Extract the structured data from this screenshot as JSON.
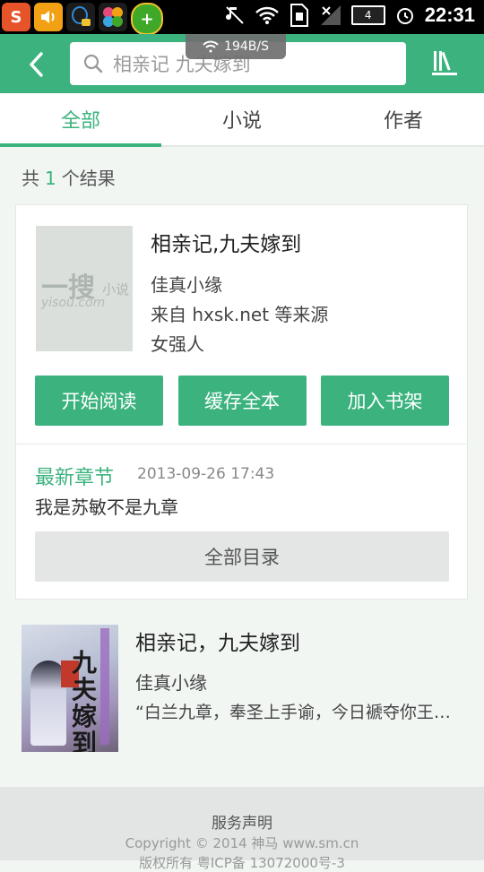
{
  "status_bar": {
    "time": "22:31",
    "battery_level": "4",
    "net_speed": "194B/S",
    "apps": [
      {
        "icon": "sogou-input-icon",
        "label": "S",
        "color": "#e8542a"
      },
      {
        "icon": "volume-app-icon",
        "label": "",
        "color": "#f2a115"
      },
      {
        "icon": "qq-icon",
        "label": "",
        "color": "#2f8bd8"
      },
      {
        "icon": "clover-app-icon",
        "label": "",
        "color": "#e44b7a"
      },
      {
        "icon": "360-security-icon",
        "label": "+",
        "color": "#40a829"
      }
    ]
  },
  "header": {
    "search_text": "相亲记 九夫嫁到",
    "back_icon": "back-arrow-icon",
    "bookshelf_icon": "bookshelf-icon"
  },
  "tabs": [
    {
      "label": "全部",
      "active": true
    },
    {
      "label": "小说",
      "active": false
    },
    {
      "label": "作者",
      "active": false
    }
  ],
  "result_summary": {
    "prefix": "共",
    "count": "1",
    "suffix": "个结果"
  },
  "main_result": {
    "title": "相亲记,九夫嫁到",
    "author": "佳真小缘",
    "source": "来自 hxsk.net 等来源",
    "category": "女强人",
    "cover_placeholder": {
      "big": "一搜",
      "small": "小说",
      "url": "yisou.com"
    },
    "buttons": {
      "read": "开始阅读",
      "cache": "缓存全本",
      "shelf": "加入书架"
    },
    "latest": {
      "label": "最新章节",
      "date": "2013-09-26 17:43",
      "chapter": "我是苏敏不是九章"
    },
    "catalog_button": "全部目录"
  },
  "second_result": {
    "title": "相亲记，九夫嫁到",
    "author": "佳真小缘",
    "description": "“白兰九章，奉圣上手谕，今日褫夺你王…",
    "cover_title": "九夫嫁到"
  },
  "footer": {
    "service": "服务声明",
    "copyright": "Copyright © 2014 神马 www.sm.cn",
    "license": "版权所有 粤ICP备 13072000号-3"
  },
  "colors": {
    "accent": "#3cb37e",
    "statusbar": "#000000"
  }
}
